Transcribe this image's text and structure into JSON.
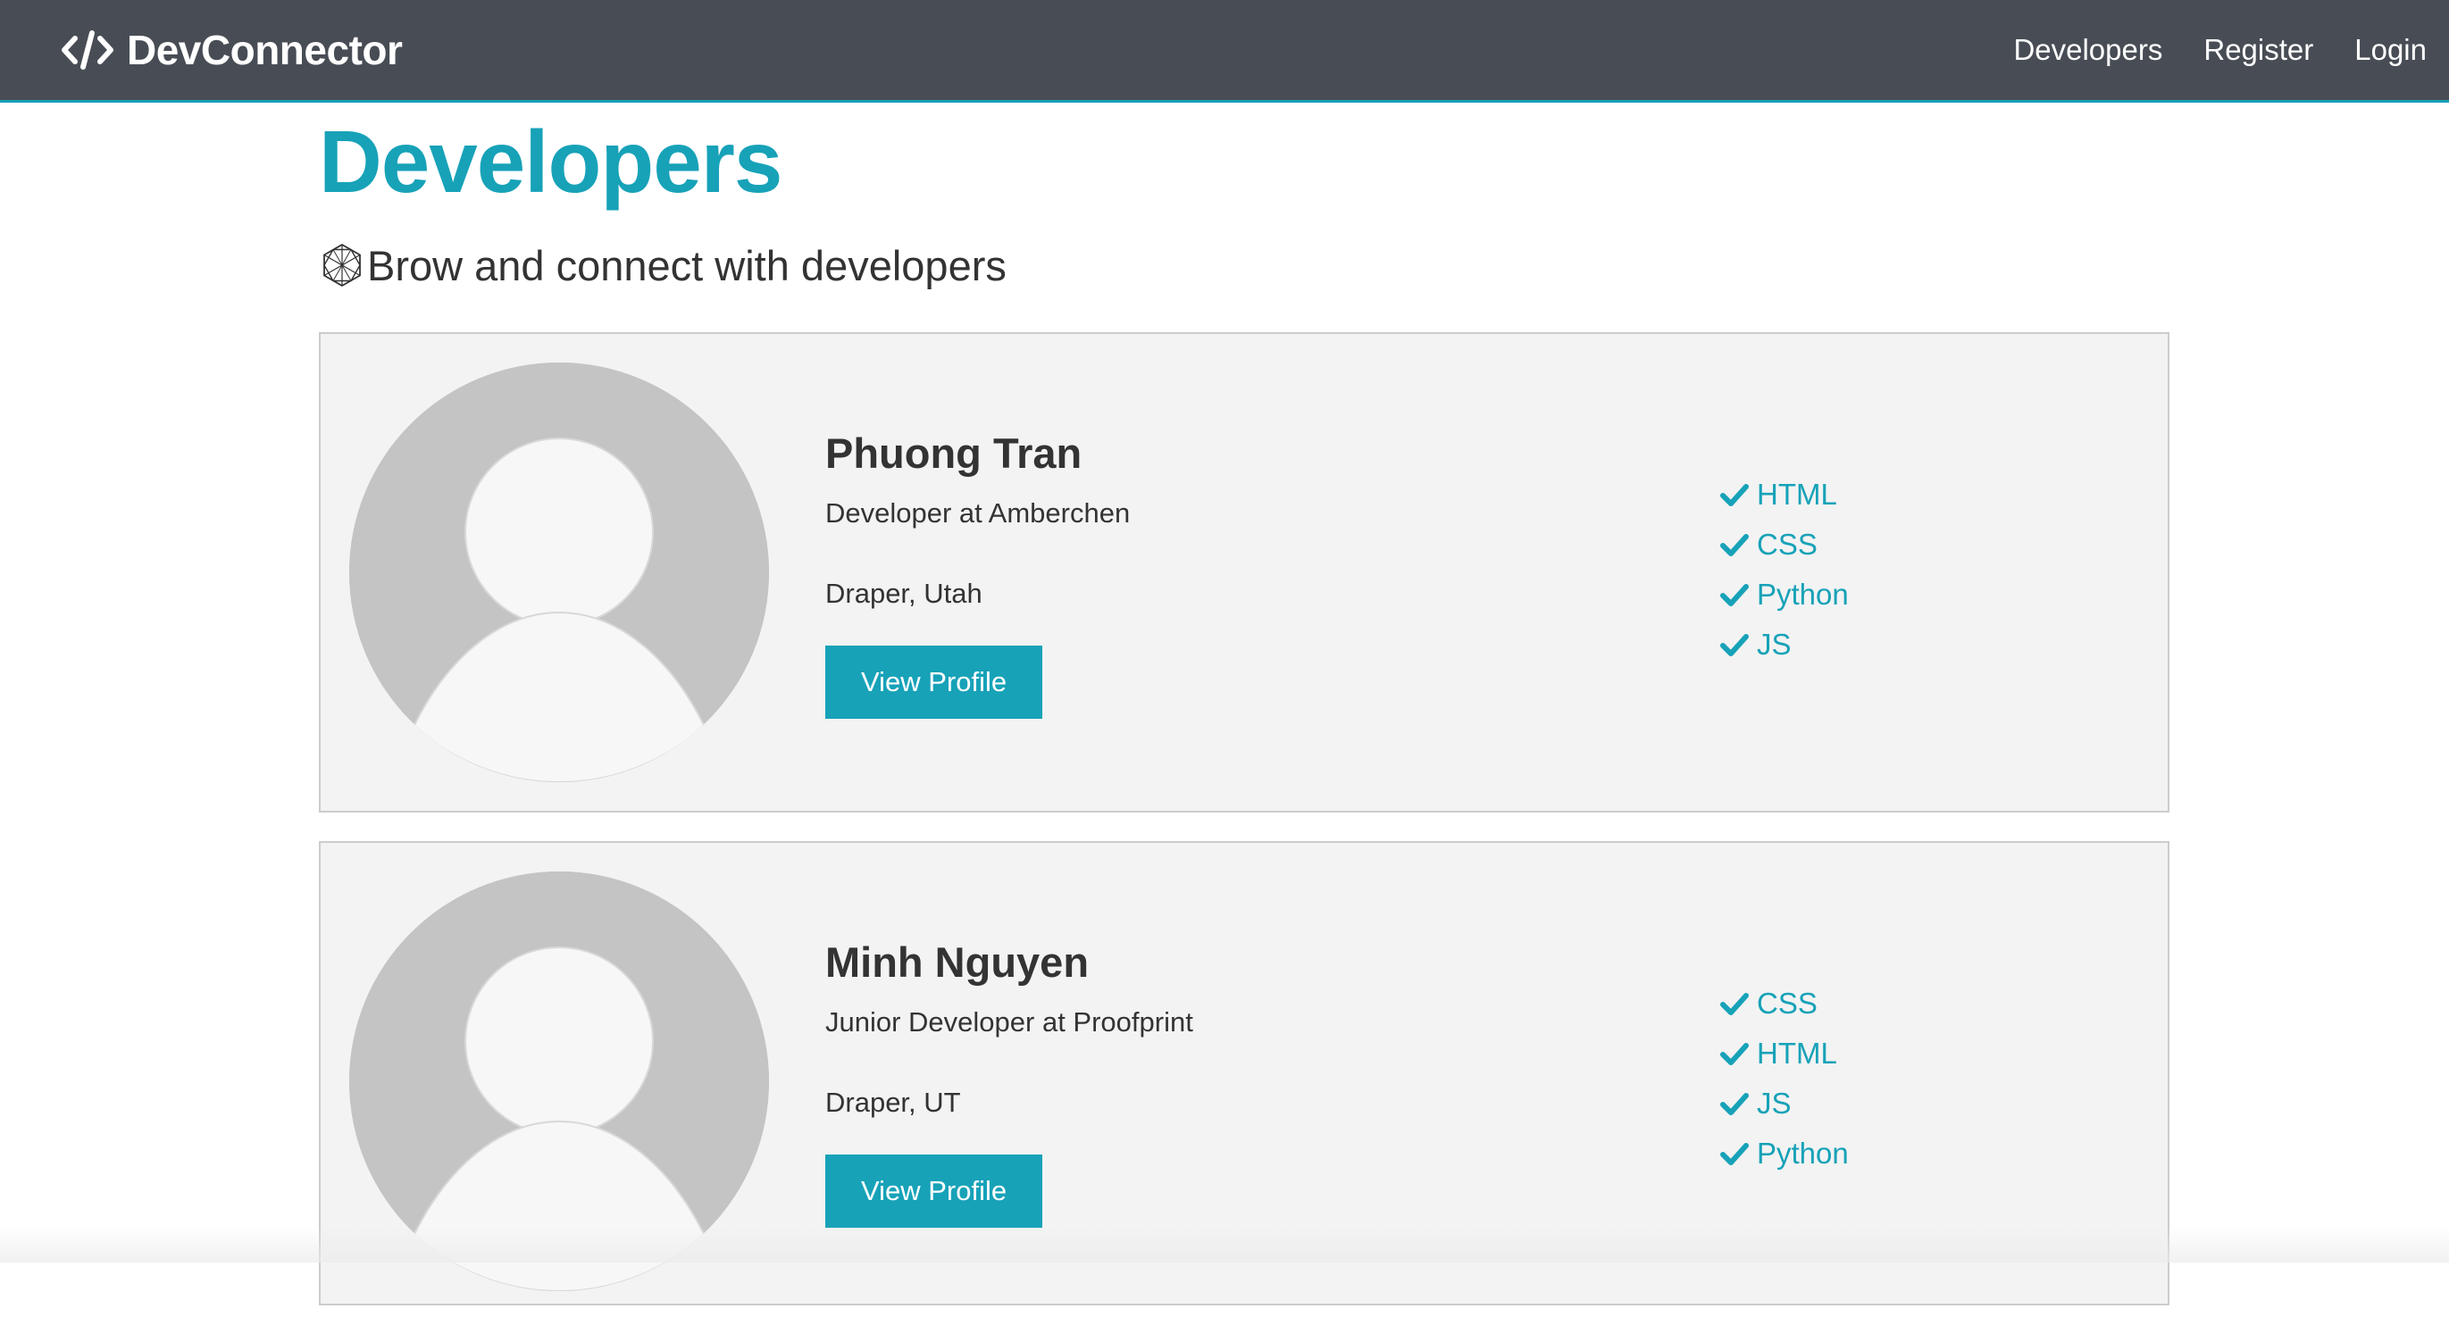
{
  "navbar": {
    "brand": "DevConnector",
    "brand_icon": "code-icon",
    "links": [
      {
        "label": "Developers"
      },
      {
        "label": "Register"
      },
      {
        "label": "Login"
      }
    ]
  },
  "page": {
    "title": "Developers",
    "lead": "Brow and connect with developers",
    "lead_icon": "connectdevelop-icon"
  },
  "profiles": [
    {
      "name": "Phuong Tran",
      "status": "Developer at Amberchen",
      "location": "Draper, Utah",
      "button_label": "View Profile",
      "skills": [
        "HTML",
        "CSS",
        "Python",
        "JS"
      ]
    },
    {
      "name": "Minh Nguyen",
      "status": "Junior Developer at Proofprint",
      "location": "Draper, UT",
      "button_label": "View Profile",
      "skills": [
        "CSS",
        "HTML",
        "JS",
        "Python"
      ]
    }
  ],
  "colors": {
    "navbar_bg": "#484d55",
    "accent": "#17a2b8",
    "card_bg": "#f3f3f3",
    "avatar_bg": "#c4c4c4"
  }
}
